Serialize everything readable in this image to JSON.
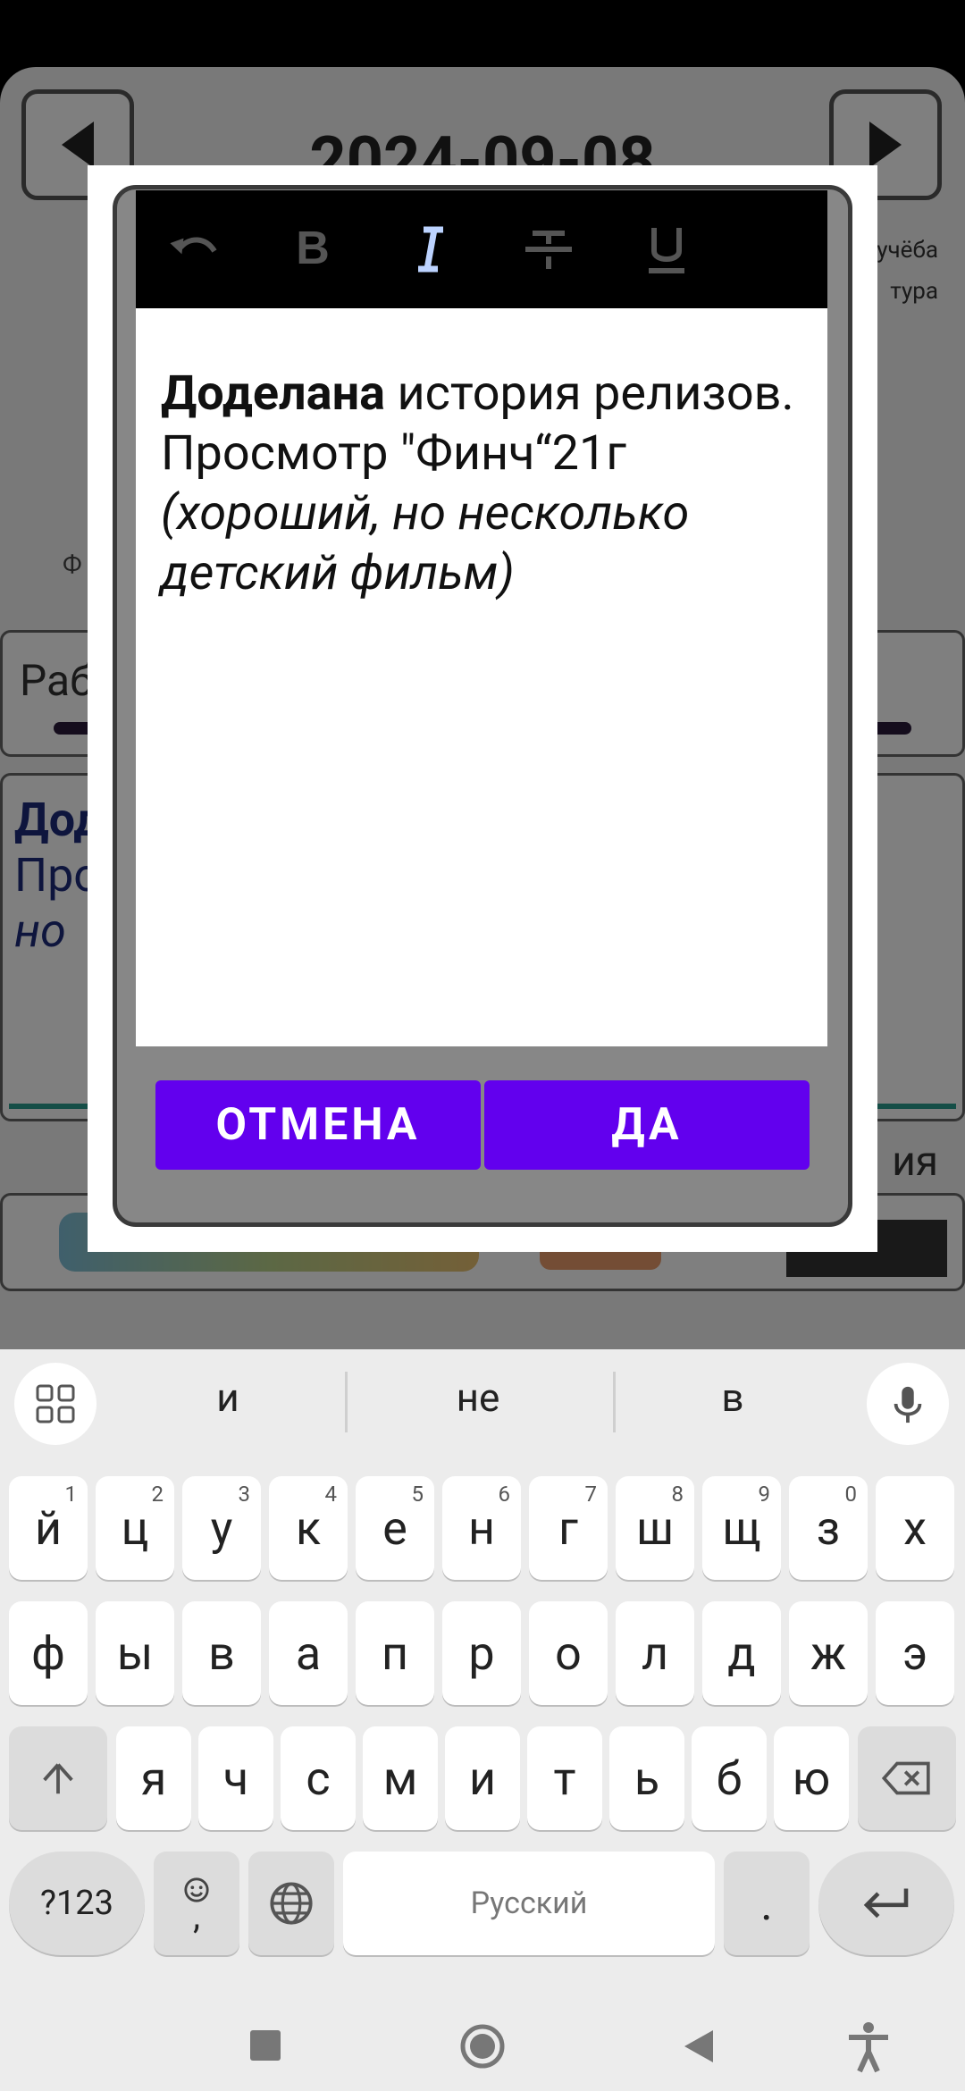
{
  "app": {
    "date": "2024-09-08",
    "side_tags": [
      "учёба",
      "тура"
    ],
    "field_label": "Ф",
    "work_label": "Раб",
    "bg_note_lines": [
      "Дод",
      "Про",
      "но"
    ],
    "bottom_label": "ия"
  },
  "dialog": {
    "toolbar": {
      "undo_icon": "undo-icon",
      "bold_icon": "bold-icon",
      "italic_icon": "italic-icon",
      "strike_icon": "strikethrough-icon",
      "underline_icon": "underline-icon"
    },
    "editor": {
      "bold_text": "Доделана",
      "text1": " история релизов.",
      "text2": "Просмотр \"Финч“21г",
      "italic_text": "(хороший, но несколько детский фильм)"
    },
    "cancel_label": "ОТМЕНА",
    "ok_label": "ДА"
  },
  "keyboard": {
    "suggestions": [
      "и",
      "не",
      "в"
    ],
    "row1": [
      {
        "k": "й",
        "h": "1"
      },
      {
        "k": "ц",
        "h": "2"
      },
      {
        "k": "у",
        "h": "3"
      },
      {
        "k": "к",
        "h": "4"
      },
      {
        "k": "е",
        "h": "5"
      },
      {
        "k": "н",
        "h": "6"
      },
      {
        "k": "г",
        "h": "7"
      },
      {
        "k": "ш",
        "h": "8"
      },
      {
        "k": "щ",
        "h": "9"
      },
      {
        "k": "з",
        "h": "0"
      },
      {
        "k": "х",
        "h": ""
      }
    ],
    "row2": [
      "ф",
      "ы",
      "в",
      "а",
      "п",
      "р",
      "о",
      "л",
      "д",
      "ж",
      "э"
    ],
    "row3": [
      "я",
      "ч",
      "с",
      "м",
      "и",
      "т",
      "ь",
      "б",
      "ю"
    ],
    "symbols_label": "?123",
    "comma_label": ",",
    "space_label": "Русский",
    "period_label": "."
  },
  "colors": {
    "accent": "#6200ee",
    "dialog_frame": "#878787",
    "toolbar": "#000000",
    "italic_active": "#bcd3ff"
  }
}
